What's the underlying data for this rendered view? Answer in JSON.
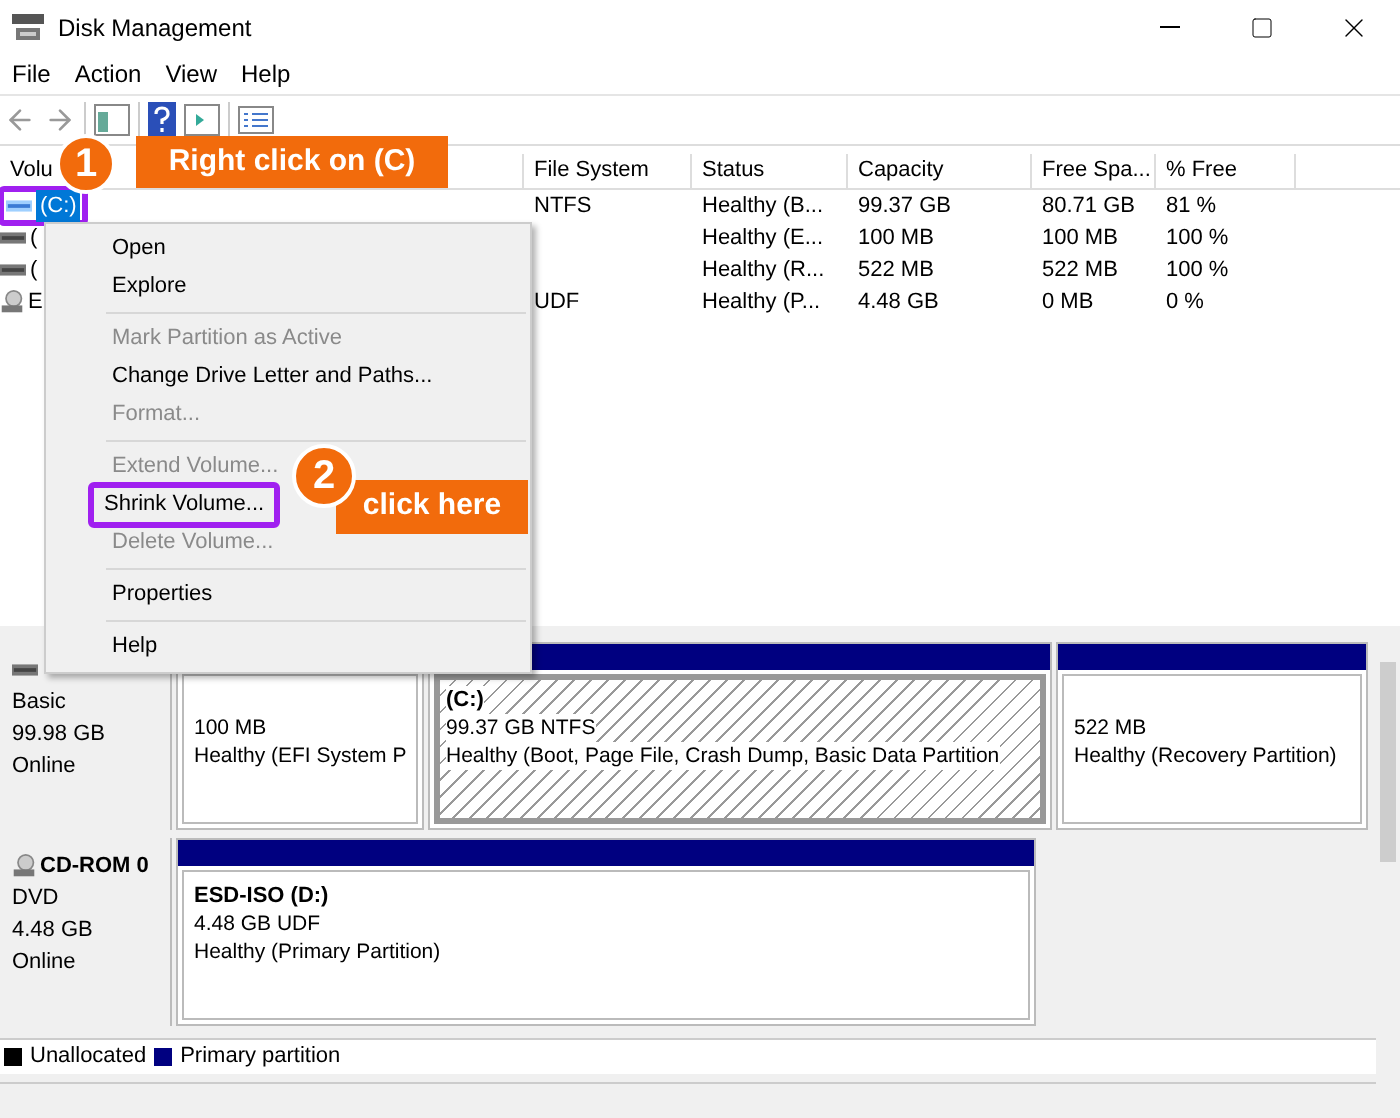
{
  "window": {
    "title": "Disk Management"
  },
  "menu_bar": [
    "File",
    "Action",
    "View",
    "Help"
  ],
  "table": {
    "columns": [
      "Volu",
      "File System",
      "Status",
      "Capacity",
      "Free Spa...",
      "% Free"
    ],
    "rows": [
      {
        "cells": [
          "(C:)",
          "NTFS",
          "Healthy (B...",
          "99.37 GB",
          "80.71 GB",
          "81 %"
        ],
        "selected": true,
        "kind": "disk"
      },
      {
        "cells": [
          "(",
          "",
          "Healthy (E...",
          "100 MB",
          "100 MB",
          "100 %"
        ],
        "selected": false,
        "kind": "disk"
      },
      {
        "cells": [
          "(",
          "",
          "Healthy (R...",
          "522 MB",
          "522 MB",
          "100 %"
        ],
        "selected": false,
        "kind": "disk"
      },
      {
        "cells": [
          "E",
          "UDF",
          "Healthy (P...",
          "4.48 GB",
          "0 MB",
          "0 %"
        ],
        "selected": false,
        "kind": "cd"
      }
    ]
  },
  "disks": [
    {
      "kind": "disk",
      "lines": [
        "Basic",
        "99.98 GB",
        "Online"
      ],
      "partitions": [
        {
          "lines": [
            "100 MB",
            "Healthy (EFI System P"
          ],
          "selected": false
        },
        {
          "title": "(C:)",
          "lines": [
            "99.37 GB NTFS",
            "Healthy (Boot, Page File, Crash Dump, Basic Data Partition"
          ],
          "selected": true
        },
        {
          "lines": [
            "522 MB",
            "Healthy (Recovery Partition)"
          ],
          "selected": false
        }
      ]
    },
    {
      "kind": "cd",
      "name": "CD-ROM 0",
      "lines": [
        "DVD",
        "4.48 GB",
        "Online"
      ],
      "partitions": [
        {
          "title": "ESD-ISO  (D:)",
          "lines": [
            "4.48 GB UDF",
            "Healthy (Primary Partition)"
          ],
          "selected": false
        }
      ]
    }
  ],
  "legend": [
    {
      "label": "Unallocated",
      "color": "#000000"
    },
    {
      "label": "Primary partition",
      "color": "#000080"
    }
  ],
  "context_menu": [
    {
      "kind": "item",
      "label": "Open",
      "disabled": false,
      "highlighted": false
    },
    {
      "kind": "item",
      "label": "Explore",
      "disabled": false,
      "highlighted": false
    },
    {
      "kind": "separator"
    },
    {
      "kind": "item",
      "label": "Mark Partition as Active",
      "disabled": true,
      "highlighted": false
    },
    {
      "kind": "item",
      "label": "Change Drive Letter and Paths...",
      "disabled": false,
      "highlighted": false
    },
    {
      "kind": "item",
      "label": "Format...",
      "disabled": true,
      "highlighted": false
    },
    {
      "kind": "separator"
    },
    {
      "kind": "item",
      "label": "Extend Volume...",
      "disabled": true,
      "highlighted": false
    },
    {
      "kind": "item",
      "label": "Shrink Volume...",
      "disabled": false,
      "highlighted": true
    },
    {
      "kind": "item",
      "label": "Delete Volume...",
      "disabled": true,
      "highlighted": false
    },
    {
      "kind": "separator"
    },
    {
      "kind": "item",
      "label": "Properties",
      "disabled": false,
      "highlighted": false
    },
    {
      "kind": "separator"
    },
    {
      "kind": "item",
      "label": "Help",
      "disabled": false,
      "highlighted": false
    }
  ],
  "annotations": [
    {
      "number": "1",
      "text": "Right click on (C)"
    },
    {
      "number": "2",
      "text": "click here"
    }
  ]
}
